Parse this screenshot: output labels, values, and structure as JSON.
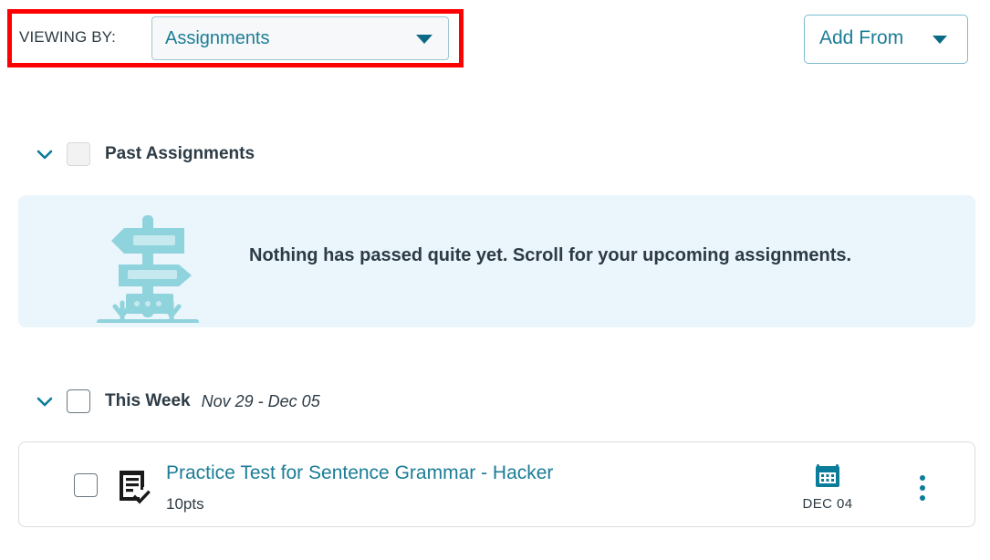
{
  "toolbar": {
    "viewing_by_label": "VIEWING BY:",
    "viewing_by_value": "Assignments",
    "viewing_by_caret_icon": "chevron-down-icon",
    "add_from_label": "Add From",
    "add_from_caret_icon": "chevron-down-icon",
    "highlight_color": "#fe0000"
  },
  "sections": [
    {
      "chevron_icon": "chevron-down-icon",
      "title": "Past Assignments",
      "date_range": "",
      "checkbox_state": "disabled",
      "empty_state": {
        "illustration_icon": "signpost-icon",
        "message": "Nothing has passed quite yet. Scroll for your upcoming assignments.",
        "background_color": "#eaf5fc"
      }
    },
    {
      "chevron_icon": "chevron-down-icon",
      "title": "This Week",
      "date_range": "Nov 29 - Dec 05",
      "checkbox_state": "enabled"
    }
  ],
  "assignments": [
    {
      "type_icon": "assignment-document-check-icon",
      "title": "Practice Test for Sentence Grammar - Hacker",
      "points": "10pts",
      "due_icon": "calendar-icon",
      "due_date": "DEC 04",
      "menu_icon": "kebab-menu-icon"
    }
  ],
  "colors": {
    "link_teal": "#1b7d96",
    "icon_teal": "#0c7c9b",
    "illustration_teal": "#8fd3dc",
    "panel_blue": "#eaf5fc",
    "text_dark": "#2d3b45"
  }
}
